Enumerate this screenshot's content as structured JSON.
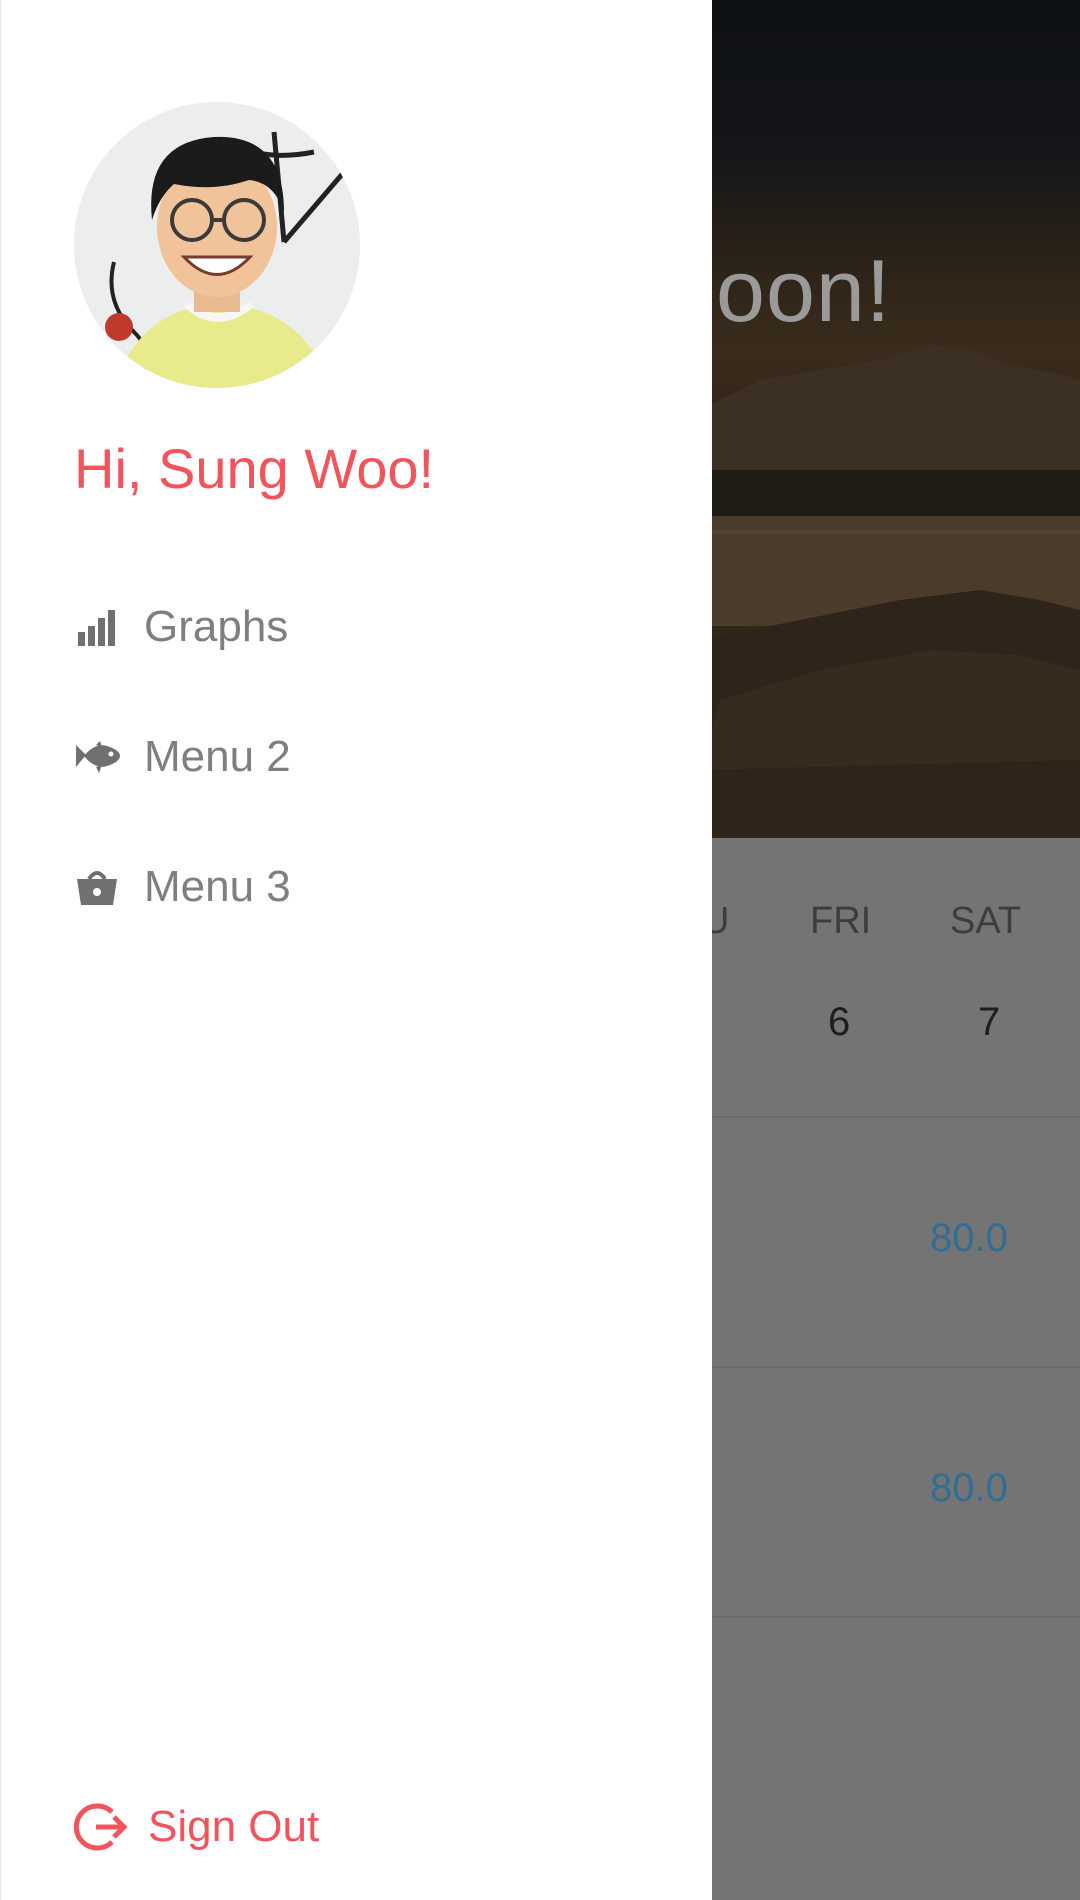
{
  "background": {
    "greeting_partial": "oon!",
    "week": {
      "days": [
        {
          "label": "U",
          "num": ""
        },
        {
          "label": "FRI",
          "num": "6"
        },
        {
          "label": "SAT",
          "num": "7"
        }
      ]
    },
    "rows": [
      {
        "value": "80.0"
      },
      {
        "value": "80.0"
      }
    ],
    "icons": {
      "notifications": "bell-icon",
      "next": "chevron-right-icon"
    }
  },
  "drawer": {
    "greeting": "Hi, Sung Woo!",
    "avatar_icon": "user-avatar",
    "menu": [
      {
        "label": "Graphs",
        "icon": "bar-chart-icon"
      },
      {
        "label": "Menu 2",
        "icon": "fish-icon"
      },
      {
        "label": "Menu 3",
        "icon": "basket-icon"
      }
    ],
    "sign_out": {
      "label": "Sign Out",
      "icon": "sign-out-icon"
    },
    "accent_color": "#f2545b"
  }
}
